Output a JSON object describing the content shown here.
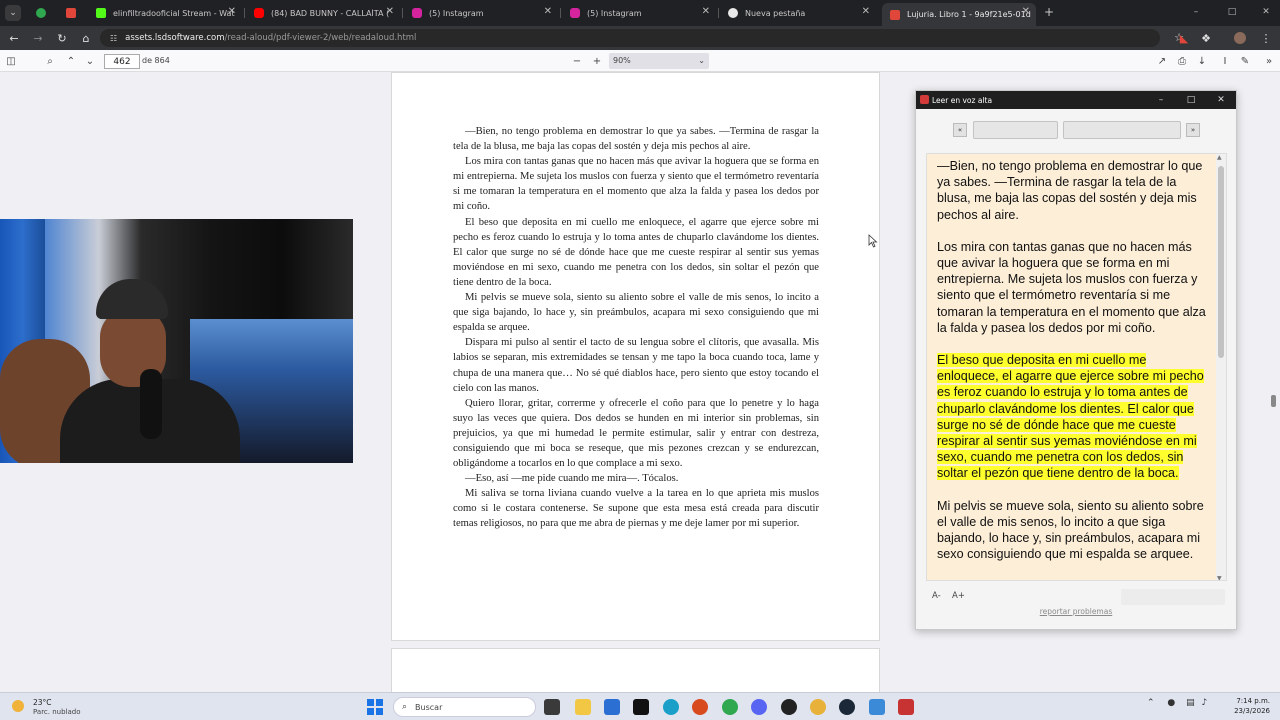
{
  "browser": {
    "tabs": [
      {
        "title": "",
        "color": "#2fa84f"
      },
      {
        "title": "",
        "color": "#e0463a"
      },
      {
        "title": "elinfiltradooficial Stream - Wat",
        "color": "#53fc18"
      },
      {
        "title": "(84) BAD BUNNY - CALLAÍTA (",
        "color": "#ff0000"
      },
      {
        "title": "(5) Instagram",
        "color": "#d6249f"
      },
      {
        "title": "(5) Instagram",
        "color": "#d6249f"
      },
      {
        "title": "Nueva pestaña",
        "color": "#e8e8e8"
      },
      {
        "title": "Lujuria. Libro 1 - 9a9f21e5-01d",
        "color": "#e0463a"
      }
    ],
    "url_host": "assets.lsdsoftware.com",
    "url_path": "/read-aloud/pdf-viewer-2/web/readaloud.html"
  },
  "pdf_toolbar": {
    "page_number": "462",
    "page_count": "de 864",
    "zoom": "90%"
  },
  "pdf_page": {
    "paragraphs": [
      "—Bien, no tengo problema en demostrar lo que ya sabes. —Termina de rasgar la tela de la blusa, me baja las copas del sostén y deja mis pechos al aire.",
      "Los mira con tantas ganas que no hacen más que avivar la hoguera que se forma en mi entrepierna. Me sujeta los muslos con fuerza y siento que el termómetro reventaría si me tomaran la temperatura en el momento que alza la falda y pasea los dedos por mi coño.",
      "El beso que deposita en mi cuello me enloquece, el agarre que ejerce sobre mi pecho es feroz cuando lo estruja y lo toma antes de chuparlo clavándome los dientes. El calor que surge no sé de dónde hace que me cueste respirar al sentir sus yemas moviéndose en mi sexo, cuando me penetra con los dedos, sin soltar el pezón que tiene dentro de la boca.",
      "Mi pelvis se mueve sola, siento su aliento sobre el valle de mis senos, lo incito a que siga bajando, lo hace y, sin preámbulos, acapara mi sexo consiguiendo que mi espalda se arquee.",
      "Dispara mi pulso al sentir el tacto de su lengua sobre el clítoris, que avasalla. Mis labios se separan, mis extremidades se tensan y me tapo la boca cuando toca, lame y chupa de una manera que… No sé qué diablos hace, pero siento que estoy tocando el cielo con las manos.",
      "Quiero llorar, gritar, correrme y ofrecerle el coño para que lo penetre y lo haga suyo las veces que quiera. Dos dedos se hunden en mi interior sin problemas, sin prejuicios, ya que mi humedad le permite estimular, salir y entrar con destreza, consiguiendo que mi boca se reseque, que mis pezones crezcan y se endurezcan, obligándome a tocarlos en lo que complace a mi sexo.",
      "—Eso, así —me pide cuando me mira—. Tócalos.",
      "Mi saliva se torna liviana cuando vuelve a la tarea en lo que aprieta mis muslos como si le costara contenerse. Se supone que esta mesa está creada para discutir temas religiosos, no para que me abra de piernas y me deje lamer por mi superior."
    ]
  },
  "reader": {
    "title": "Leer en voz alta",
    "prev_label": "«",
    "next_label": "»",
    "paragraphs": [
      {
        "text": "—Bien, no tengo problema en demostrar lo que ya sabes. —Termina de rasgar la tela de la blusa, me baja las copas del sostén y deja mis pechos al aire.",
        "highlighted": false
      },
      {
        "text": "Los mira con tantas ganas que no hacen más que avivar la hoguera que se forma en mi entrepierna. Me sujeta los muslos con fuerza y siento que el termómetro reventaría si me tomaran la temperatura en el momento que alza la falda y pasea los dedos por mi coño.",
        "highlighted": false
      },
      {
        "text": "El beso que deposita en mi cuello me enloquece, el agarre que ejerce sobre mi pecho es feroz cuando lo estruja y lo toma antes de chuparlo clavándome los dientes. El calor que surge no sé de dónde hace que me cueste respirar al sentir sus yemas moviéndose en mi sexo, cuando me penetra con los dedos, sin soltar el pezón que tiene dentro de la boca.",
        "highlighted": true
      },
      {
        "text": "Mi pelvis se mueve sola, siento su aliento sobre el valle de mis senos, lo incito a que siga bajando, lo hace y, sin preámbulos, acapara mi sexo consiguiendo que mi espalda se arquee.",
        "highlighted": false
      }
    ],
    "font_decrease": "A-",
    "font_increase": "A+",
    "report_link": "reportar problemas",
    "highlight_color": "#ffff2e",
    "background_color": "#fdeed8"
  },
  "taskbar": {
    "temperature": "23°C",
    "condition": "Parc. nublado",
    "search_placeholder": "Buscar",
    "time": "7:14 p.m.",
    "date": "23/3/2026"
  }
}
